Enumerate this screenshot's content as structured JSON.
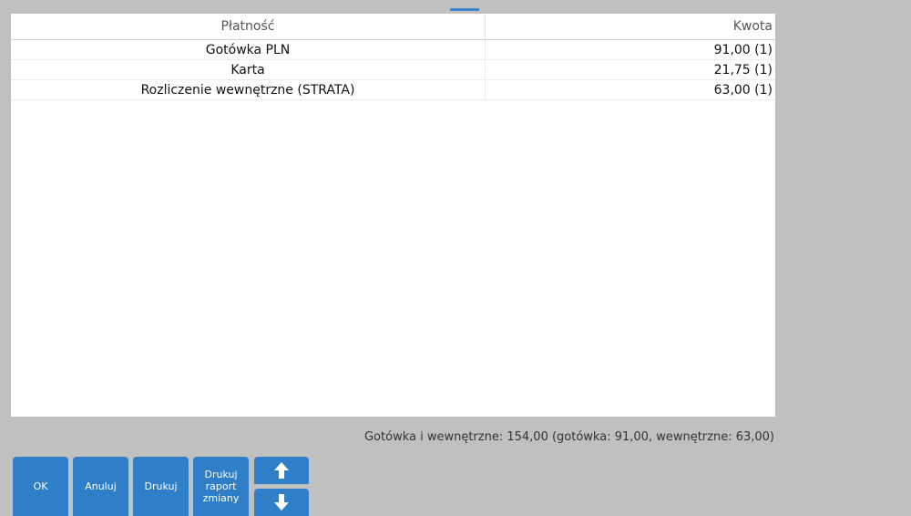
{
  "table": {
    "headers": {
      "payment": "Płatność",
      "amount": "Kwota"
    },
    "rows": [
      {
        "payment": "Gotówka PLN",
        "amount": "91,00 (1)"
      },
      {
        "payment": "Karta",
        "amount": "21,75 (1)"
      },
      {
        "payment": "Rozliczenie wewnętrzne (STRATA)",
        "amount": "63,00 (1)"
      }
    ]
  },
  "summary": "Gotówka i wewnętrzne: 154,00 (gotówka: 91,00, wewnętrzne: 63,00)",
  "buttons": {
    "ok": "OK",
    "cancel": "Anuluj",
    "print": "Drukuj",
    "print_shift_report": "Drukuj raport zmiany",
    "up_icon": "arrow-up-icon",
    "down_icon": "arrow-down-icon"
  },
  "colors": {
    "background": "#c0c0c0",
    "button": "#2f7fc8",
    "panel": "#ffffff"
  }
}
